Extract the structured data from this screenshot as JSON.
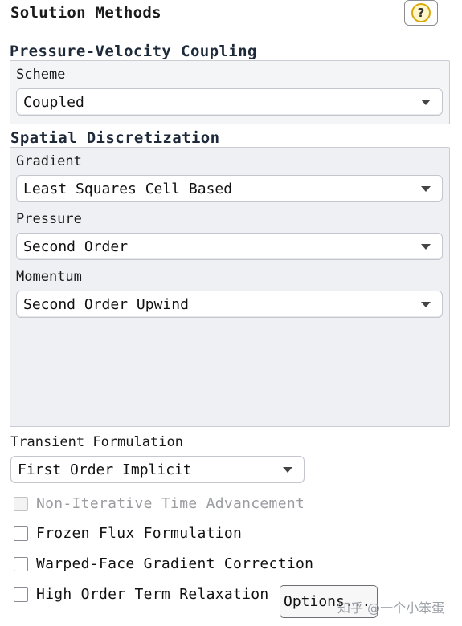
{
  "panel": {
    "title": "Solution Methods"
  },
  "help_icon": "help-question-icon",
  "pv_coupling": {
    "title": "Pressure-Velocity Coupling",
    "scheme_label": "Scheme",
    "scheme_value": "Coupled"
  },
  "spatial": {
    "title": "Spatial Discretization",
    "gradient_label": "Gradient",
    "gradient_value": "Least Squares Cell Based",
    "pressure_label": "Pressure",
    "pressure_value": "Second Order",
    "momentum_label": "Momentum",
    "momentum_value": "Second Order Upwind"
  },
  "transient": {
    "label": "Transient Formulation",
    "value": "First Order Implicit"
  },
  "checkboxes": [
    {
      "label": "Non-Iterative Time Advancement",
      "checked": false,
      "disabled": true
    },
    {
      "label": "Frozen Flux Formulation",
      "checked": false,
      "disabled": false
    },
    {
      "label": "Warped-Face Gradient Correction",
      "checked": false,
      "disabled": false
    },
    {
      "label": "High Order Term Relaxation",
      "checked": false,
      "disabled": false
    }
  ],
  "options_button": "Options...",
  "watermark": "知乎 @一个小笨蛋"
}
